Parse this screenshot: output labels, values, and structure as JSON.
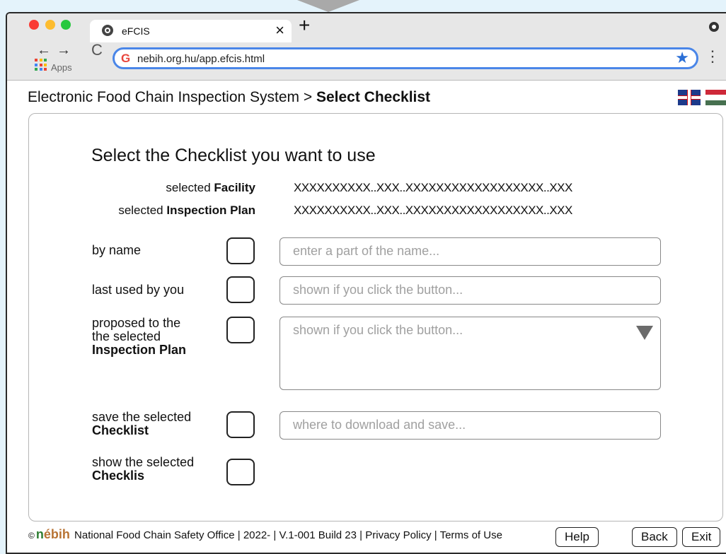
{
  "browser": {
    "tab_title": "eFCIS",
    "tab_close": "×",
    "new_tab": "+",
    "url": "nebih.org.hu/app.efcis.html",
    "apps_label": "Apps",
    "back_glyph": "←",
    "forward_glyph": "→",
    "reload_glyph": "C",
    "menu_glyph": "⋮",
    "star_glyph": "★",
    "google_glyph": "G",
    "icons": [
      "back-arrow-icon",
      "forward-arrow-icon",
      "reload-icon",
      "apps-grid-icon",
      "google-icon",
      "bookmark-star-icon",
      "menu-dots-icon"
    ]
  },
  "header": {
    "breadcrumb_app": "Electronic Food Chain Inspection System",
    "breadcrumb_sep": " > ",
    "breadcrumb_page": "Select Checklist",
    "flags": [
      "uk-flag-icon",
      "hungary-flag-icon"
    ]
  },
  "main": {
    "heading": "Select the Checklist you want to use",
    "facility_label_prefix": "selected ",
    "facility_label_bold": "Facility",
    "facility_value": "XXXXXXXXXX..XXX..XXXXXXXXXXXXXXXXXX..XXX",
    "plan_label_prefix": "selected ",
    "plan_label_bold": "Inspection Plan",
    "plan_value": "XXXXXXXXXX..XXX..XXXXXXXXXXXXXXXXXX..XXX",
    "rows": [
      {
        "label": "by name",
        "placeholder": "enter a part of the name..."
      },
      {
        "label": "last used by you",
        "placeholder": "shown if you click the button..."
      },
      {
        "label_line1": "proposed to the",
        "label_line2": "the selected",
        "label_bold": "Inspection Plan",
        "placeholder": "shown if you click the button..."
      },
      {
        "label_line1": "save the selected",
        "label_bold": "Checklist",
        "placeholder": "where to download and save..."
      },
      {
        "label_line1": "show the selected",
        "label_bold": "Checklis"
      }
    ]
  },
  "footer": {
    "copyright": "©",
    "logo_pre": "n",
    "logo_rest": "ébih",
    "org": "National Food Chain Safety Office",
    "year": "2022-",
    "version": "V.1-001 Build 23",
    "privacy": "Privacy Policy",
    "terms": "Terms of Use",
    "separator": "|",
    "help": "Help",
    "back": "Back",
    "exit": "Exit"
  },
  "colors": {
    "page_bg": "#e4f3fb",
    "address_border": "#4a86e8",
    "traffic_red": "#fa3c35",
    "traffic_yellow": "#fdbc2f",
    "traffic_green": "#27c83f"
  }
}
